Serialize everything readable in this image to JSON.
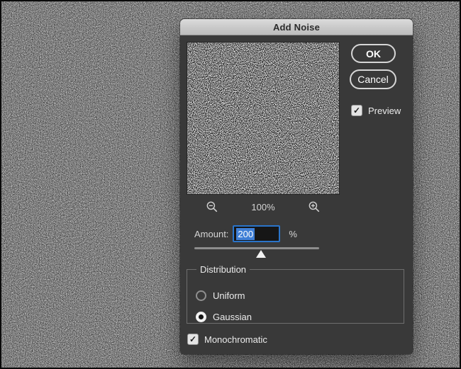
{
  "window": {
    "title": "Add Noise"
  },
  "preview_controls": {
    "zoom_level": "100%"
  },
  "amount": {
    "label": "Amount:",
    "value": "200",
    "unit": "%"
  },
  "slider": {
    "value": 200,
    "position_pct": 48
  },
  "distribution": {
    "legend": "Distribution",
    "options": [
      {
        "label": "Uniform",
        "selected": false
      },
      {
        "label": "Gaussian",
        "selected": true
      }
    ]
  },
  "monochromatic": {
    "label": "Monochromatic",
    "checked": true
  },
  "preview": {
    "label": "Preview",
    "checked": true
  },
  "buttons": {
    "ok": "OK",
    "cancel": "Cancel"
  },
  "icons": {
    "checkmark": "✓",
    "zoom_out": "magnifier-minus",
    "zoom_in": "magnifier-plus"
  },
  "colors": {
    "dialog_bg": "#393939",
    "titlebar_text": "#2b2b2b",
    "focus_border_blue": "#2a74c9",
    "selection_blue": "#3f7fd6",
    "canvas_gray": "#7f7f7f"
  }
}
